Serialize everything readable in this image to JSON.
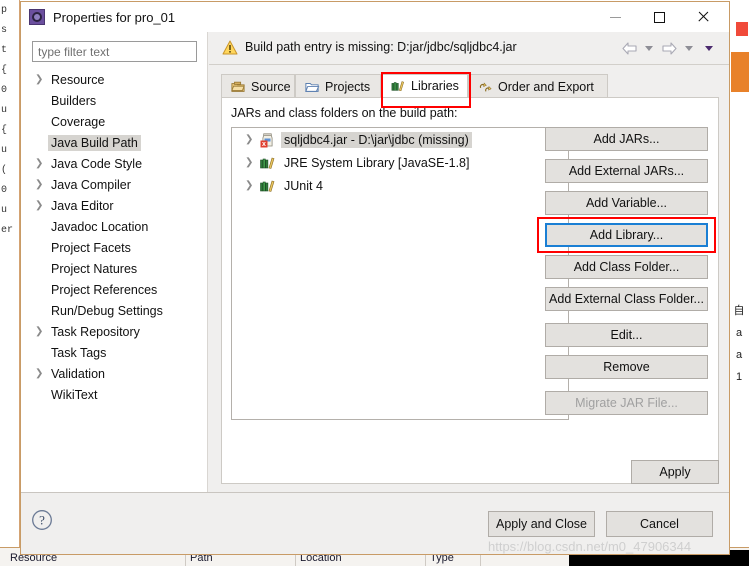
{
  "window": {
    "title": "Properties for pro_01",
    "icon": "eclipse-properties-icon",
    "minimize_label": "—",
    "maximize_label": "□",
    "close_label": "✕"
  },
  "sidebar": {
    "filter": {
      "value": "",
      "placeholder": "type filter text"
    },
    "items": [
      {
        "label": "Resource",
        "expandable": true,
        "selected": false
      },
      {
        "label": "Builders",
        "expandable": false,
        "selected": false
      },
      {
        "label": "Coverage",
        "expandable": false,
        "selected": false
      },
      {
        "label": "Java Build Path",
        "expandable": false,
        "selected": true
      },
      {
        "label": "Java Code Style",
        "expandable": true,
        "selected": false
      },
      {
        "label": "Java Compiler",
        "expandable": true,
        "selected": false
      },
      {
        "label": "Java Editor",
        "expandable": true,
        "selected": false
      },
      {
        "label": "Javadoc Location",
        "expandable": false,
        "selected": false
      },
      {
        "label": "Project Facets",
        "expandable": false,
        "selected": false
      },
      {
        "label": "Project Natures",
        "expandable": false,
        "selected": false
      },
      {
        "label": "Project References",
        "expandable": false,
        "selected": false
      },
      {
        "label": "Run/Debug Settings",
        "expandable": false,
        "selected": false
      },
      {
        "label": "Task Repository",
        "expandable": true,
        "selected": false
      },
      {
        "label": "Task Tags",
        "expandable": false,
        "selected": false
      },
      {
        "label": "Validation",
        "expandable": true,
        "selected": false
      },
      {
        "label": "WikiText",
        "expandable": false,
        "selected": false
      }
    ]
  },
  "warning": {
    "icon": "warning-triangle-icon",
    "text": "Build path entry is missing: D:jar/jdbc/sqljdbc4.jar"
  },
  "nav": {
    "back_icon": "arrow-left-icon",
    "back_caret_icon": "caret-down-icon",
    "forward_icon": "arrow-right-icon",
    "forward_caret_icon": "caret-down-icon",
    "menu_caret_icon": "caret-down-icon"
  },
  "tabs": [
    {
      "label": "Source",
      "icon": "source-folder-icon",
      "active": false
    },
    {
      "label": "Projects",
      "icon": "open-folder-icon",
      "active": false
    },
    {
      "label": "Libraries",
      "icon": "libraries-books-icon",
      "active": true
    },
    {
      "label": "Order and Export",
      "icon": "order-export-icon",
      "active": false
    }
  ],
  "main": {
    "list_label": "JARs and class folders on the build path:",
    "entries": [
      {
        "label": "sqljdbc4.jar - D:\\jar\\jdbc (missing)",
        "icon": "jar-error-icon",
        "selected": true
      },
      {
        "label": "JRE System Library [JavaSE-1.8]",
        "icon": "libraries-books-icon",
        "selected": false
      },
      {
        "label": "JUnit 4",
        "icon": "libraries-books-icon",
        "selected": false
      }
    ],
    "side_buttons": [
      {
        "label": "Add JARs...",
        "state": "normal"
      },
      {
        "label": "Add External JARs...",
        "state": "normal"
      },
      {
        "label": "Add Variable...",
        "state": "normal"
      },
      {
        "label": "Add Library...",
        "state": "focused"
      },
      {
        "label": "Add Class Folder...",
        "state": "normal"
      },
      {
        "label": "Add External Class Folder...",
        "state": "normal"
      },
      {
        "label": "Edit...",
        "state": "normal",
        "gap": true
      },
      {
        "label": "Remove",
        "state": "normal"
      },
      {
        "label": "Migrate JAR File...",
        "state": "disabled",
        "gap": true
      }
    ],
    "apply_label": "Apply"
  },
  "footer": {
    "help_icon": "help-question-icon",
    "apply_and_close_label": "Apply and Close",
    "cancel_label": "Cancel"
  },
  "background": {
    "code_lines": [
      "p",
      "",
      "",
      "",
      "s",
      "",
      "t",
      "",
      "",
      "{",
      "0",
      "u",
      "",
      "",
      "",
      "{",
      "",
      "u",
      "",
      "",
      "",
      "(",
      "0",
      "",
      "u",
      "",
      "",
      "er"
    ],
    "table_headers": [
      "Resource",
      "Path",
      "Location",
      "Type"
    ]
  },
  "watermark": {
    "text": "https://blog.csdn.net/m0_47906344"
  },
  "colors": {
    "accent_focus": "#1a7fd4",
    "highlight_box": "#ff0000",
    "window_border": "#c89b66",
    "selection": "#d6d4d0",
    "dialog_bg": "#f0efee"
  }
}
